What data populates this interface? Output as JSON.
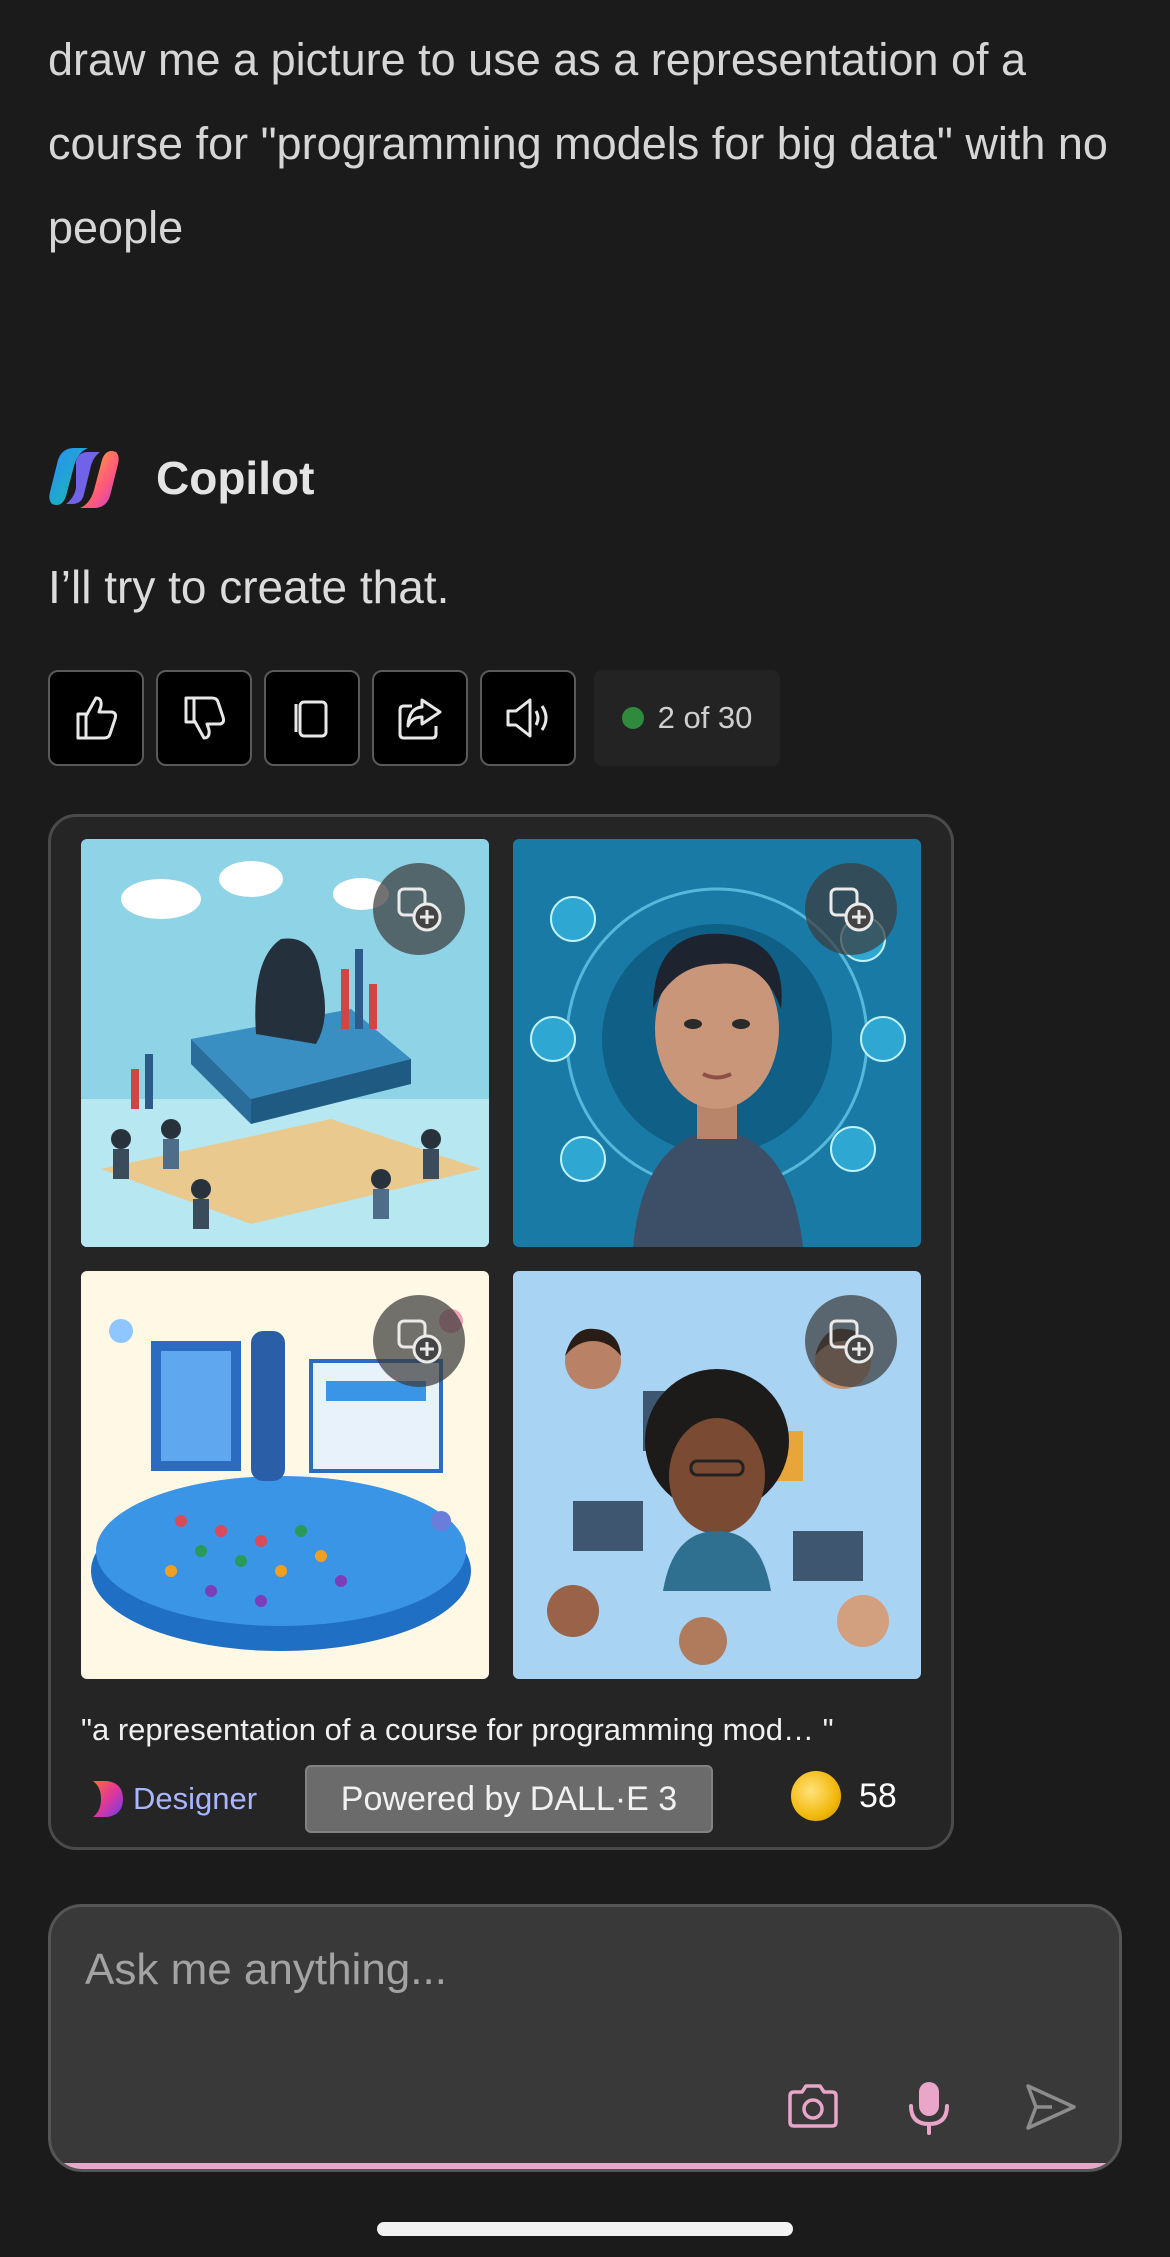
{
  "user_message": "draw me a picture to use as a representation of a course for \"programming models for big data\" with no people",
  "assistant": {
    "name": "Copilot",
    "reply": "I’ll try to create that."
  },
  "actions": {
    "like": "thumbs-up-icon",
    "dislike": "thumbs-down-icon",
    "copy": "copy-icon",
    "share": "share-icon",
    "read_aloud": "speaker-icon",
    "turn_counter": "2 of 30",
    "status_color": "#2f8a3e"
  },
  "image_card": {
    "caption": "\"a representation of a course for programming mod…  \"",
    "designer_label": "Designer",
    "powered_by": "Powered by DALL·E 3",
    "boosts": "58",
    "images": [
      {
        "description_icon": "data-center-meeting-image",
        "palette": "#7ec9e0"
      },
      {
        "description_icon": "man-portrait-network-image",
        "palette": "#1f8fb8"
      },
      {
        "description_icon": "people-on-platform-image",
        "palette": "#fff9e6"
      },
      {
        "description_icon": "diverse-faces-collage-image",
        "palette": "#9fcdee"
      }
    ]
  },
  "composer": {
    "placeholder": "Ask me anything..."
  }
}
